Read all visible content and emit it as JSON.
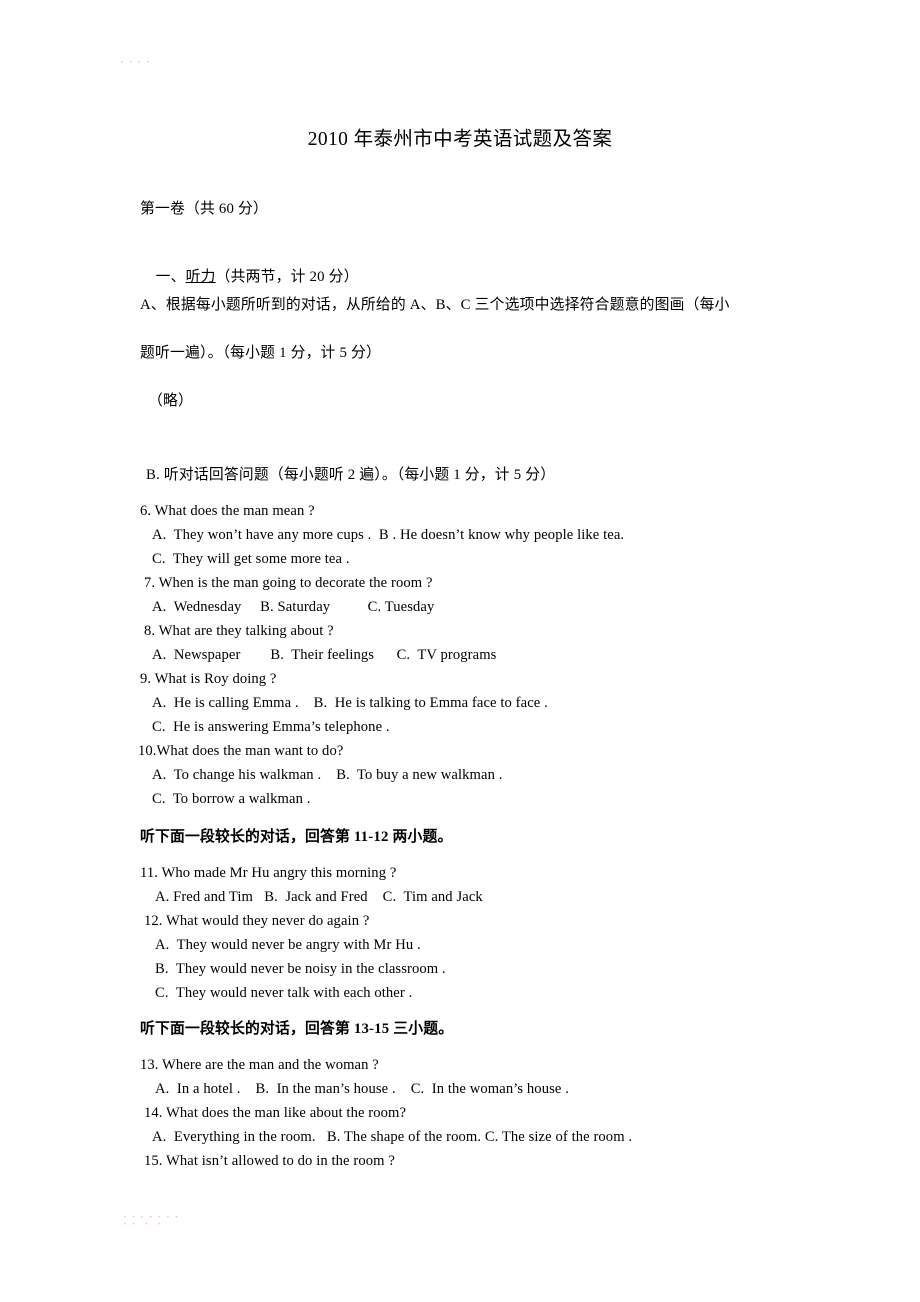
{
  "document": {
    "title": "2010 年泰州市中考英语试题及答案",
    "paper_part": "第一卷（共 60 分）",
    "watermark_top": "• • • •",
    "watermark_bottom": "• • • • • • •\n• •  •  •"
  },
  "section_listening": {
    "heading_prefix": "一、",
    "heading_underlined": "听力",
    "heading_suffix": "（共两节，计 20 分）",
    "part_a_line1": "A、根据每小题所听到的对话，从所给的 A、B、C 三个选项中选择符合题意的图画（每小",
    "part_a_line2": "题听一遍）。（每小题 1 分，计 5 分）",
    "part_a_omitted": "（略）",
    "part_b_heading": "B. 听对话回答问题（每小题听 2 遍）。（每小题 1 分，计 5 分）",
    "long_dialogue_heading_1": "听下面一段较长的对话，回答第 11-12 两小题。",
    "long_dialogue_heading_2": "听下面一段较长的对话，回答第 13-15 三小题。"
  },
  "questions": [
    {
      "number": "6.",
      "stem": "6. What does the man mean ?",
      "option_lines": [
        "A.  They won’t have any more cups .  B . He doesn’t know why people like tea.",
        "C.  They will get some more tea ."
      ]
    },
    {
      "number": "7.",
      "stem": "7. When is the man going to decorate the room ?",
      "option_lines": [
        "A.  Wednesday     B. Saturday          C. Tuesday"
      ]
    },
    {
      "number": "8.",
      "stem": "8. What are they talking about ?",
      "option_lines": [
        "A.  Newspaper        B.  Their feelings      C.  TV programs"
      ]
    },
    {
      "number": "9.",
      "stem": "9. What is Roy doing ?",
      "option_lines": [
        "A.  He is calling Emma .    B.  He is talking to Emma face to face .",
        "C.  He is answering Emma’s telephone ."
      ]
    },
    {
      "number": "10.",
      "stem": "10.What does the man want to do?",
      "option_lines": [
        "A.  To change his walkman .    B.  To buy a new walkman .",
        "C.  To borrow a walkman ."
      ]
    },
    {
      "number": "11.",
      "stem": "11. Who made Mr Hu angry this morning ?",
      "option_lines": [
        "A. Fred and Tim   B.  Jack and Fred    C.  Tim and Jack"
      ]
    },
    {
      "number": "12.",
      "stem": "12. What would they never do again ?",
      "option_lines": [
        "A.  They would never be angry with Mr Hu .",
        "B.  They would never be noisy in the classroom .",
        "C.  They would never talk with each other ."
      ]
    },
    {
      "number": "13.",
      "stem": "13. Where are the man and the woman ?",
      "option_lines": [
        "A.  In a hotel .    B.  In the man’s house .    C.  In the woman’s house ."
      ]
    },
    {
      "number": "14.",
      "stem": "14. What does the man like about the room?",
      "option_lines": [
        "A.  Everything in the room.   B. The shape of the room. C. The size of the room ."
      ]
    },
    {
      "number": "15.",
      "stem": "15. What isn’t allowed to do in the room ?",
      "option_lines": []
    }
  ]
}
